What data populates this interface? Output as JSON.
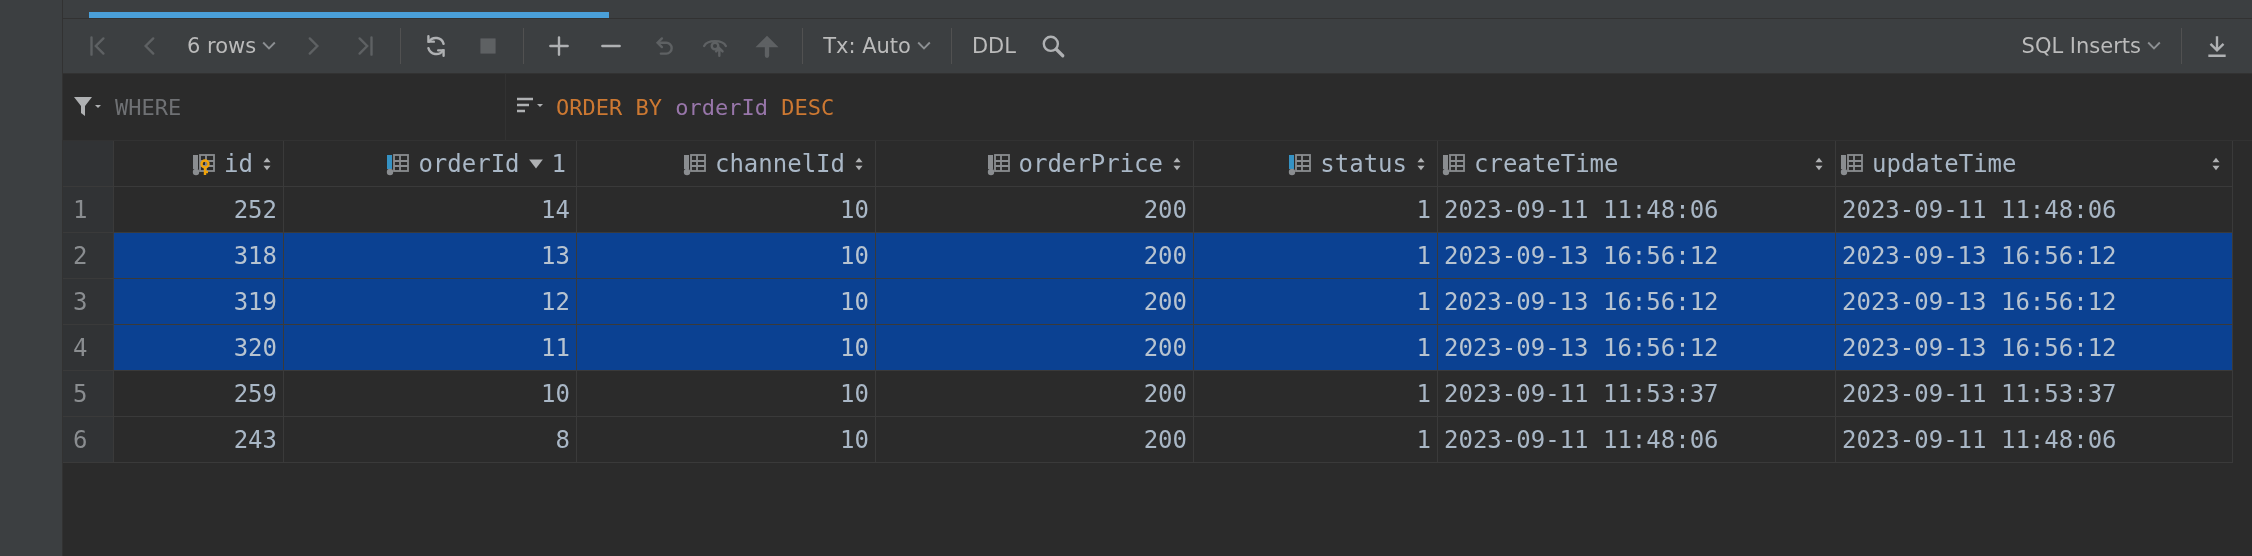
{
  "toolbar": {
    "left": [
      {
        "kind": "first",
        "disabled": true
      },
      {
        "kind": "prev",
        "disabled": true
      },
      {
        "kind": "dropdown",
        "label": "6 rows"
      },
      {
        "kind": "next",
        "disabled": true
      },
      {
        "kind": "last",
        "disabled": true
      },
      {
        "kind": "separator"
      },
      {
        "kind": "refresh",
        "disabled": false
      },
      {
        "kind": "stop",
        "disabled": true
      },
      {
        "kind": "separator"
      },
      {
        "kind": "add",
        "disabled": false
      },
      {
        "kind": "remove",
        "disabled": false
      },
      {
        "kind": "revert",
        "disabled": true
      },
      {
        "kind": "preview",
        "disabled": true
      },
      {
        "kind": "submit",
        "disabled": true
      },
      {
        "kind": "separator"
      },
      {
        "kind": "dropdown",
        "label": "Tx: Auto"
      },
      {
        "kind": "separator"
      },
      {
        "kind": "text",
        "label": "DDL"
      },
      {
        "kind": "search",
        "disabled": false
      }
    ],
    "right": [
      {
        "kind": "dropdown",
        "label": "SQL Inserts"
      },
      {
        "kind": "separator"
      },
      {
        "kind": "download",
        "disabled": false
      }
    ]
  },
  "filter": {
    "placeholder": "WHERE",
    "order_by": [
      {
        "kind": "keyword",
        "text": "ORDER BY"
      },
      {
        "kind": "column",
        "text": "orderId"
      },
      {
        "kind": "keyword",
        "text": "DESC"
      }
    ]
  },
  "table": {
    "columns": [
      {
        "name": "id",
        "kind": "key",
        "sorted": false
      },
      {
        "name": "orderId",
        "kind": "indexed",
        "sorted": true,
        "sort_order": "1"
      },
      {
        "name": "channelId",
        "kind": "number",
        "sorted": false
      },
      {
        "name": "orderPrice",
        "kind": "number",
        "sorted": false
      },
      {
        "name": "status",
        "kind": "indexed",
        "sorted": false
      },
      {
        "name": "createTime",
        "kind": "datetime",
        "sorted": false
      },
      {
        "name": "updateTime",
        "kind": "datetime",
        "sorted": false
      }
    ],
    "rows": [
      {
        "number": "1",
        "selected": false,
        "cells": [
          "252",
          "14",
          "10",
          "200",
          "1",
          "2023-09-11 11:48:06",
          "2023-09-11 11:48:06"
        ]
      },
      {
        "number": "2",
        "selected": true,
        "cells": [
          "318",
          "13",
          "10",
          "200",
          "1",
          "2023-09-13 16:56:12",
          "2023-09-13 16:56:12"
        ]
      },
      {
        "number": "3",
        "selected": true,
        "cells": [
          "319",
          "12",
          "10",
          "200",
          "1",
          "2023-09-13 16:56:12",
          "2023-09-13 16:56:12"
        ]
      },
      {
        "number": "4",
        "selected": true,
        "cells": [
          "320",
          "11",
          "10",
          "200",
          "1",
          "2023-09-13 16:56:12",
          "2023-09-13 16:56:12"
        ]
      },
      {
        "number": "5",
        "selected": false,
        "cells": [
          "259",
          "10",
          "10",
          "200",
          "1",
          "2023-09-11 11:53:37",
          "2023-09-11 11:53:37"
        ]
      },
      {
        "number": "6",
        "selected": false,
        "cells": [
          "243",
          "8",
          "10",
          "200",
          "1",
          "2023-09-11 11:48:06",
          "2023-09-11 11:48:06"
        ]
      }
    ]
  }
}
